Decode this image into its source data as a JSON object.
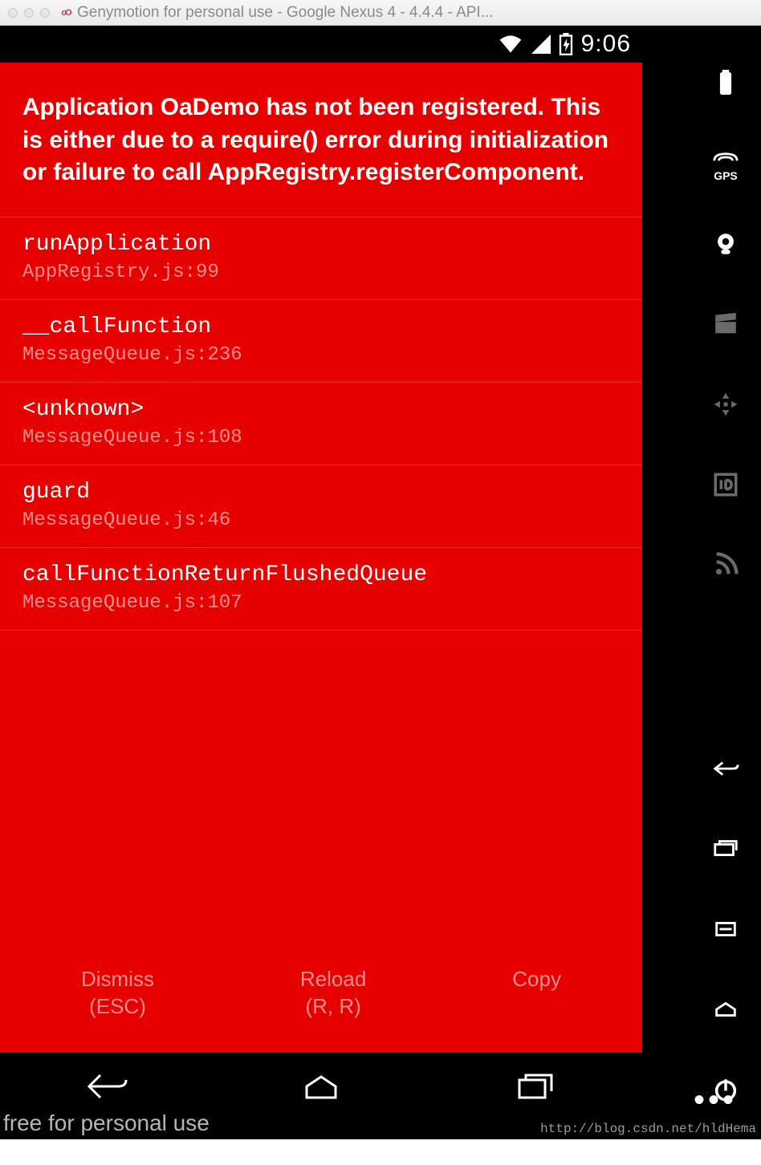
{
  "window": {
    "title": "Genymotion for personal use - Google Nexus 4 - 4.4.4 - API..."
  },
  "statusbar": {
    "time": "9:06"
  },
  "error": {
    "message": "Application OaDemo has not been registered. This is either due to a require() error during initialization or failure to call AppRegistry.registerComponent.",
    "stack": [
      {
        "fn": "runApplication",
        "loc": "AppRegistry.js:99"
      },
      {
        "fn": "__callFunction",
        "loc": "MessageQueue.js:236"
      },
      {
        "fn": "<unknown>",
        "loc": "MessageQueue.js:108"
      },
      {
        "fn": "guard",
        "loc": "MessageQueue.js:46"
      },
      {
        "fn": "callFunctionReturnFlushedQueue",
        "loc": "MessageQueue.js:107"
      }
    ],
    "actions": {
      "dismiss_label": "Dismiss",
      "dismiss_hint": "(ESC)",
      "reload_label": "Reload",
      "reload_hint": "(R, R)",
      "copy_label": "Copy"
    }
  },
  "emu_sidebar": {
    "gps_label": "GPS"
  },
  "footer": {
    "text": "free for personal use",
    "watermark": "http://blog.csdn.net/hldHema"
  }
}
